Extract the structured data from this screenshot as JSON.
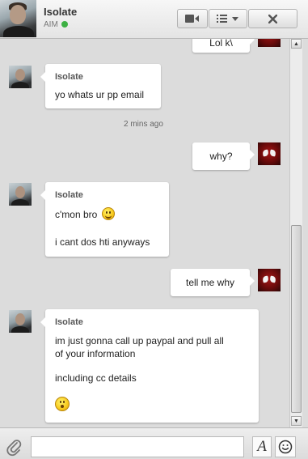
{
  "header": {
    "contact_name": "Isolate",
    "status_service": "AIM",
    "status_color": "#3cb043",
    "icons": [
      "video-camera-icon",
      "list-menu-icon",
      "chevron-down-icon",
      "close-icon"
    ]
  },
  "messages": [
    {
      "from": "me",
      "lines": [
        "Lol k\\"
      ]
    },
    {
      "from": "them",
      "sender": "Isolate",
      "lines": [
        "yo whats ur pp email"
      ]
    },
    {
      "type": "timestamp",
      "text": "2 mins ago"
    },
    {
      "from": "me",
      "lines": [
        "why?"
      ]
    },
    {
      "from": "them",
      "sender": "Isolate",
      "lines": [
        "c'mon bro",
        "i cant dos hti anyways"
      ],
      "emoji": "smile-emoji-icon"
    },
    {
      "from": "me",
      "lines": [
        "tell me why"
      ]
    },
    {
      "from": "them",
      "sender": "Isolate",
      "lines": [
        "im just gonna call up paypal and pull all",
        "of your information",
        "including cc details"
      ],
      "emoji": "surprised-emoji-icon"
    }
  ],
  "composer": {
    "placeholder": "",
    "format_label": "A",
    "icons": [
      "paperclip-icon",
      "text-format-icon",
      "emoticon-icon"
    ]
  },
  "colors": {
    "background": "#dcdcdc",
    "bubble": "#ffffff",
    "status_online": "#3cb043"
  }
}
